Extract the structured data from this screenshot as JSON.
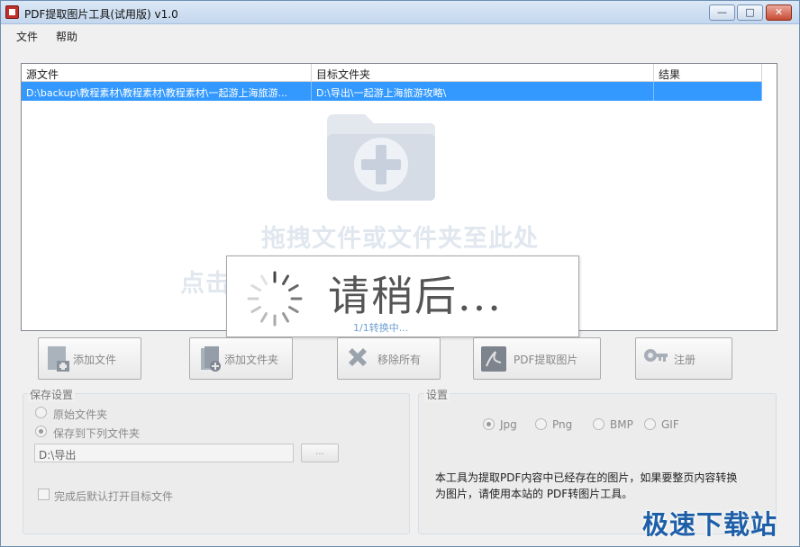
{
  "window": {
    "title": "PDF提取图片工具(试用版) v1.0"
  },
  "menu": {
    "file": "文件",
    "help": "帮助"
  },
  "file_list": {
    "columns": [
      "源文件",
      "目标文件夹",
      "结果"
    ],
    "rows": [
      {
        "source": "D:\\backup\\教程素材\\教程素材\\教程素材\\一起游上海旅游...",
        "target": "D:\\导出\\一起游上海旅游攻略\\",
        "result": ""
      }
    ],
    "drop_hint": "拖拽文件或文件夹至此处",
    "click_hint": "点击"
  },
  "loading": {
    "title": "请稍后...",
    "progress": "1/1转换中..."
  },
  "toolbar": {
    "add_file": "添加文件",
    "add_folder": "添加文件夹",
    "remove_all": "移除所有",
    "extract": "PDF提取图片",
    "register": "注册"
  },
  "save_settings": {
    "title": "保存设置",
    "original_folder": "原始文件夹",
    "save_to": "保存到下列文件夹",
    "selected": "save_to",
    "path": "D:\\导出",
    "browse": "...",
    "open_after": "完成后默认打开目标文件",
    "open_after_checked": false
  },
  "settings": {
    "title": "设置",
    "formats": [
      "Jpg",
      "Png",
      "BMP",
      "GIF"
    ],
    "selected_format": "Jpg",
    "note": "本工具为提取PDF内容中已经存在的图片，如果要整页内容转换为图片，请使用本站的 PDF转图片工具。"
  },
  "watermark": {
    "brand": "极速下载站"
  },
  "colors": {
    "selection": "#3399ff",
    "accent": "#1f5fa8"
  }
}
